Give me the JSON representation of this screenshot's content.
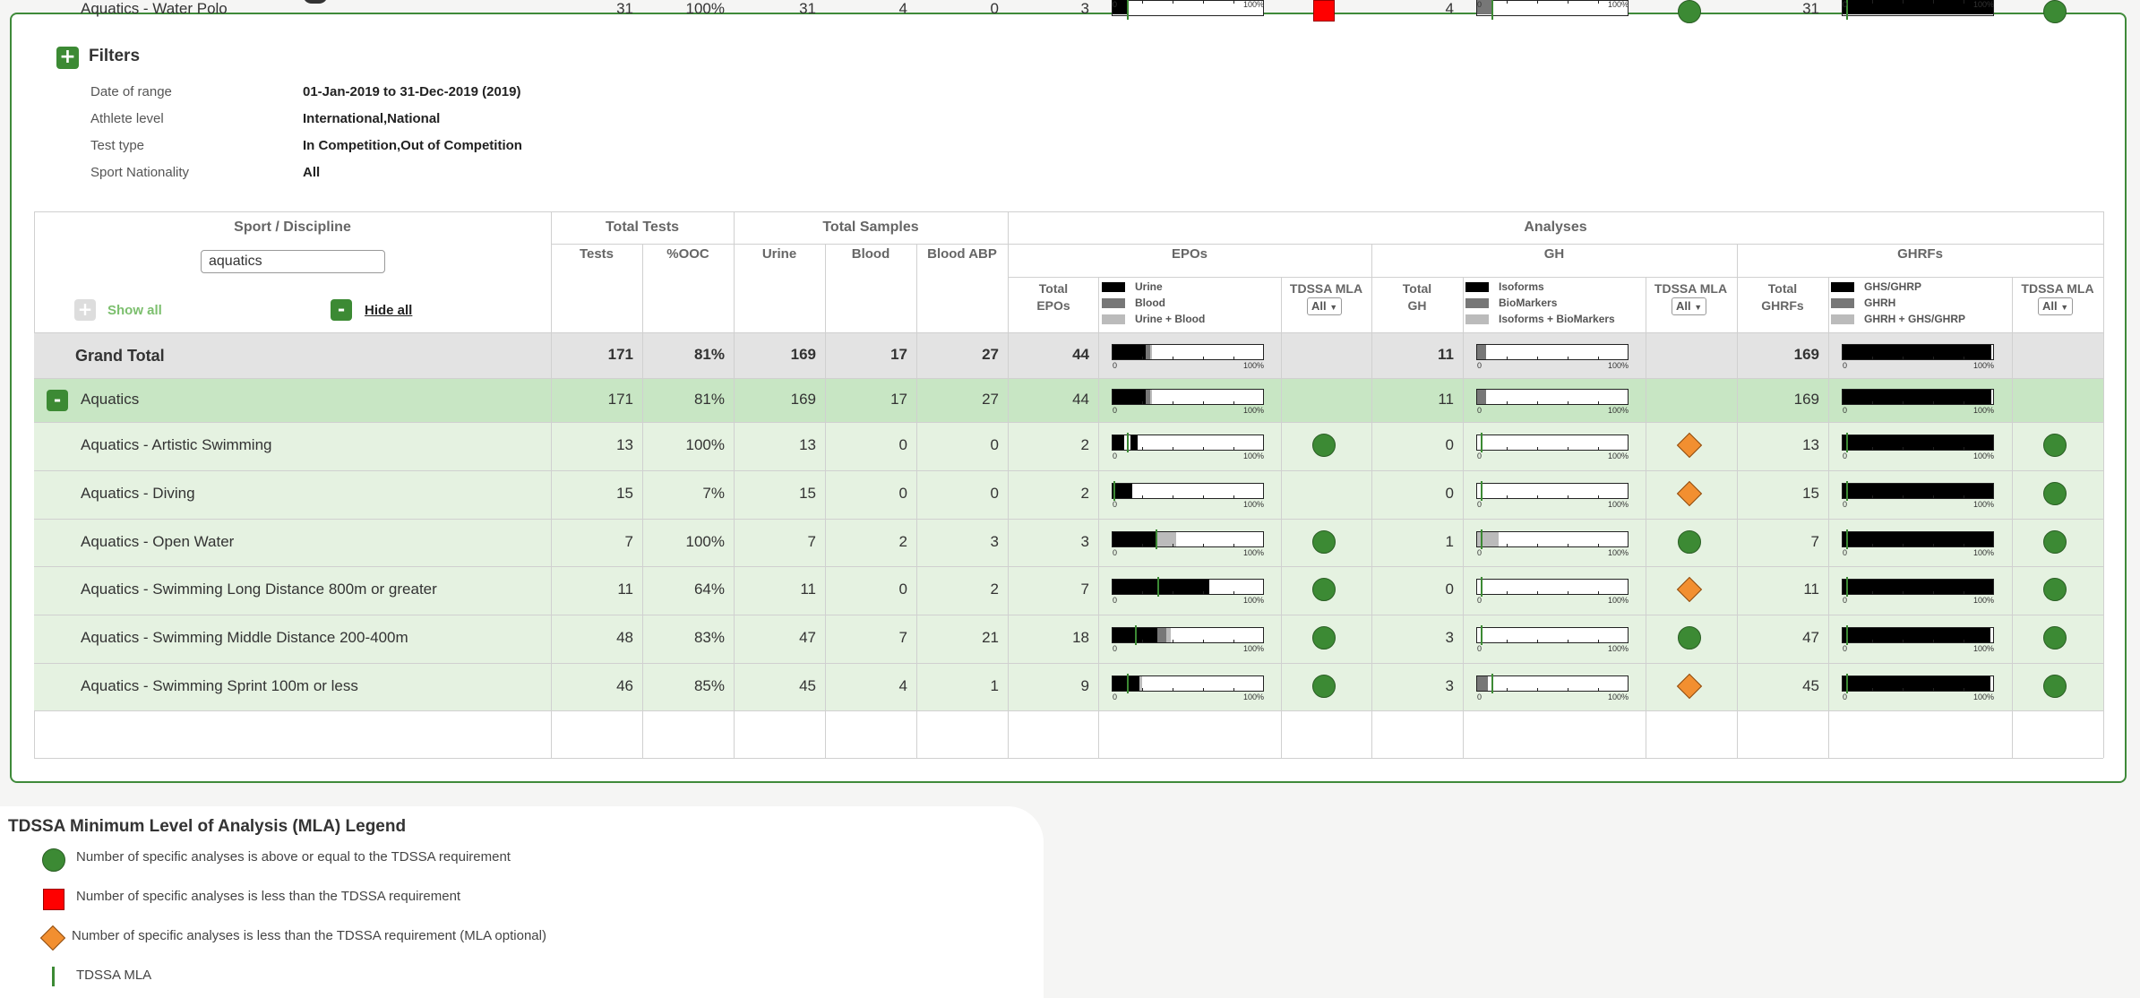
{
  "filters": {
    "title": "Filters",
    "items": [
      {
        "label": "Date of range",
        "value": "01-Jan-2019 to 31-Dec-2019 (2019)"
      },
      {
        "label": "Athlete level",
        "value": "International,National"
      },
      {
        "label": "Test type",
        "value": "In Competition,Out of Competition"
      },
      {
        "label": "Sport Nationality",
        "value": "All"
      }
    ]
  },
  "table": {
    "headers": {
      "sport_discipline": "Sport / Discipline",
      "total_tests": "Total Tests",
      "total_samples": "Total Samples",
      "analyses": "Analyses",
      "tests": "Tests",
      "ooc": "%OOC",
      "urine": "Urine",
      "blood": "Blood",
      "blood_abp": "Blood ABP",
      "epos": "EPOs",
      "gh": "GH",
      "ghrfs": "GHRFs",
      "total_epos_1": "Total",
      "total_epos_2": "EPOs",
      "total_gh_1": "Total",
      "total_gh_2": "GH",
      "total_ghrfs_1": "Total",
      "total_ghrfs_2": "GHRFs",
      "tdssa_mla": "TDSSA MLA",
      "select_all": "All"
    },
    "search_value": "aquatics",
    "show_all": "Show all",
    "hide_all": "Hide all",
    "legend_epos": [
      "Urine",
      "Blood",
      "Urine + Blood"
    ],
    "legend_gh": [
      "Isoforms",
      "BioMarkers",
      "Isoforms + BioMarkers"
    ],
    "legend_ghrfs": [
      "GHS/GHRP",
      "GHRH",
      "GHRH + GHS/GHRP"
    ],
    "bar_min": "0",
    "bar_max": "100%",
    "rows": [
      {
        "name": "Grand Total",
        "tests": "171",
        "ooc": "81%",
        "urine": "169",
        "blood": "17",
        "abp": "27",
        "epos": "44",
        "gh": "11",
        "ghrfs": "169",
        "epo_bar": [
          0.22,
          0.03,
          0.01
        ],
        "epo_mla": null,
        "gh_bar": [
          0.0,
          0.06,
          0.0
        ],
        "gh_mla": null,
        "ghrf_bar": [
          0.99,
          0.0,
          0.0
        ],
        "ghrf_mla": null,
        "epo_status": "",
        "gh_status": "",
        "ghrf_status": ""
      },
      {
        "name": "Aquatics",
        "tests": "171",
        "ooc": "81%",
        "urine": "169",
        "blood": "17",
        "abp": "27",
        "epos": "44",
        "gh": "11",
        "ghrfs": "169",
        "epo_bar": [
          0.22,
          0.03,
          0.01
        ],
        "epo_mla": null,
        "gh_bar": [
          0.0,
          0.06,
          0.0
        ],
        "gh_mla": null,
        "ghrf_bar": [
          0.99,
          0.0,
          0.0
        ],
        "ghrf_mla": null,
        "epo_status": "",
        "gh_status": "",
        "ghrf_status": ""
      },
      {
        "name": "Aquatics - Artistic Swimming",
        "tests": "13",
        "ooc": "100%",
        "urine": "13",
        "blood": "0",
        "abp": "0",
        "epos": "2",
        "gh": "0",
        "ghrfs": "13",
        "epo_bar": [
          0.08,
          0.0,
          0.0
        ],
        "epo_mla": 0.1,
        "gh_bar": [
          0.0,
          0.0,
          0.0
        ],
        "gh_mla": 0.03,
        "ghrf_bar": [
          1.0,
          0.0,
          0.0
        ],
        "ghrf_mla": 0.03,
        "epo_status": "circle",
        "gh_status": "diamond",
        "ghrf_status": "circle",
        "epo_extra": [
          0.12,
          0.05
        ]
      },
      {
        "name": "Aquatics - Diving",
        "tests": "15",
        "ooc": "7%",
        "urine": "15",
        "blood": "0",
        "abp": "0",
        "epos": "2",
        "gh": "0",
        "ghrfs": "15",
        "epo_bar": [
          0.13,
          0.0,
          0.0
        ],
        "epo_mla": 0.01,
        "gh_bar": [
          0.0,
          0.0,
          0.0
        ],
        "gh_mla": 0.03,
        "ghrf_bar": [
          1.0,
          0.0,
          0.0
        ],
        "ghrf_mla": 0.03,
        "epo_status": "",
        "gh_status": "diamond",
        "ghrf_status": "circle"
      },
      {
        "name": "Aquatics - Open Water",
        "tests": "7",
        "ooc": "100%",
        "urine": "7",
        "blood": "2",
        "abp": "3",
        "epos": "3",
        "gh": "1",
        "ghrfs": "7",
        "epo_bar": [
          0.29,
          0.0,
          0.13
        ],
        "epo_mla": 0.29,
        "gh_bar": [
          0.0,
          0.0,
          0.14
        ],
        "gh_mla": 0.03,
        "ghrf_bar": [
          1.0,
          0.0,
          0.0
        ],
        "ghrf_mla": 0.03,
        "epo_status": "circle",
        "gh_status": "circle",
        "ghrf_status": "circle"
      },
      {
        "name": "Aquatics - Swimming Long Distance 800m or greater",
        "tests": "11",
        "ooc": "64%",
        "urine": "11",
        "blood": "0",
        "abp": "2",
        "epos": "7",
        "gh": "0",
        "ghrfs": "11",
        "epo_bar": [
          0.64,
          0.0,
          0.0
        ],
        "epo_mla": 0.3,
        "gh_bar": [
          0.0,
          0.0,
          0.0
        ],
        "gh_mla": 0.03,
        "ghrf_bar": [
          1.0,
          0.0,
          0.0
        ],
        "ghrf_mla": 0.03,
        "epo_status": "circle",
        "gh_status": "diamond",
        "ghrf_status": "circle"
      },
      {
        "name": "Aquatics - Swimming Middle Distance 200-400m",
        "tests": "48",
        "ooc": "83%",
        "urine": "47",
        "blood": "7",
        "abp": "21",
        "epos": "18",
        "gh": "3",
        "ghrfs": "47",
        "epo_bar": [
          0.3,
          0.06,
          0.03
        ],
        "epo_mla": 0.15,
        "gh_bar": [
          0.0,
          0.0,
          0.0
        ],
        "gh_mla": 0.03,
        "ghrf_bar": [
          0.98,
          0.0,
          0.0
        ],
        "ghrf_mla": 0.03,
        "epo_status": "circle",
        "gh_status": "circle",
        "ghrf_status": "circle"
      },
      {
        "name": "Aquatics - Swimming Sprint 100m or less",
        "tests": "46",
        "ooc": "85%",
        "urine": "45",
        "blood": "4",
        "abp": "1",
        "epos": "9",
        "gh": "3",
        "ghrfs": "45",
        "epo_bar": [
          0.18,
          0.0,
          0.02
        ],
        "epo_mla": 0.1,
        "gh_bar": [
          0.0,
          0.07,
          0.0
        ],
        "gh_mla": 0.1,
        "ghrf_bar": [
          0.98,
          0.0,
          0.0
        ],
        "ghrf_mla": 0.03,
        "epo_status": "circle",
        "gh_status": "diamond",
        "ghrf_status": "circle",
        "epo_extra": [
          0.08,
          0.1
        ]
      },
      {
        "name": "Aquatics - Water Polo",
        "tests": "31",
        "ooc": "100%",
        "urine": "31",
        "blood": "4",
        "abp": "0",
        "epos": "3",
        "gh": "4",
        "ghrfs": "31",
        "epo_bar": [
          0.1,
          0.0,
          0.0
        ],
        "epo_mla": 0.1,
        "gh_bar": [
          0.0,
          0.1,
          0.0
        ],
        "gh_mla": 0.1,
        "ghrf_bar": [
          1.0,
          0.0,
          0.0
        ],
        "ghrf_mla": 0.03,
        "epo_status": "square",
        "gh_status": "circle",
        "ghrf_status": "circle"
      }
    ]
  },
  "legend": {
    "title": "TDSSA Minimum Level of Analysis (MLA) Legend",
    "items": [
      "Number of specific analyses is above or equal to the TDSSA requirement",
      "Number of specific analyses is less than the TDSSA requirement",
      "Number of specific analyses is less than the TDSSA requirement (MLA optional)",
      "TDSSA MLA"
    ]
  },
  "colors": {
    "accent": "#3c8a34",
    "row_green": "#e5f2e1",
    "aquatics_row": "#c8e6c4",
    "grand_row": "#e3e3e3",
    "circle": "#3c8a34",
    "square": "#ff0000",
    "diamond": "#f28f30"
  }
}
